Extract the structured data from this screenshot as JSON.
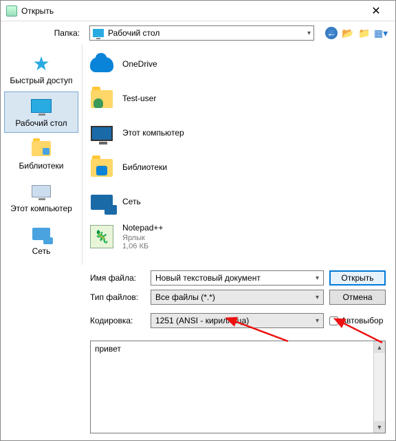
{
  "dialog": {
    "title": "Открыть"
  },
  "folder": {
    "label": "Папка:",
    "value": "Рабочий стол"
  },
  "sidebar": {
    "items": [
      {
        "label": "Быстрый доступ"
      },
      {
        "label": "Рабочий стол"
      },
      {
        "label": "Библиотеки"
      },
      {
        "label": "Этот компьютер"
      },
      {
        "label": "Сеть"
      }
    ]
  },
  "files": [
    {
      "name": "OneDrive",
      "sub": ""
    },
    {
      "name": "Test-user",
      "sub": ""
    },
    {
      "name": "Этот компьютер",
      "sub": ""
    },
    {
      "name": "Библиотеки",
      "sub": ""
    },
    {
      "name": "Сеть",
      "sub": ""
    },
    {
      "name": "Notepad++",
      "sub": "Ярлык",
      "sub2": "1,06 КБ"
    }
  ],
  "form": {
    "filename_label": "Имя файла:",
    "filename_value": "Новый текстовый документ",
    "filetype_label": "Тип файлов:",
    "filetype_value": "Все файлы (*.*)",
    "encoding_label": "Кодировка:",
    "encoding_value": "1251  (ANSI - кириллица)",
    "auto_label": "Автовыбор",
    "open_btn": "Открыть",
    "cancel_btn": "Отмена"
  },
  "preview": {
    "text": "привет"
  }
}
